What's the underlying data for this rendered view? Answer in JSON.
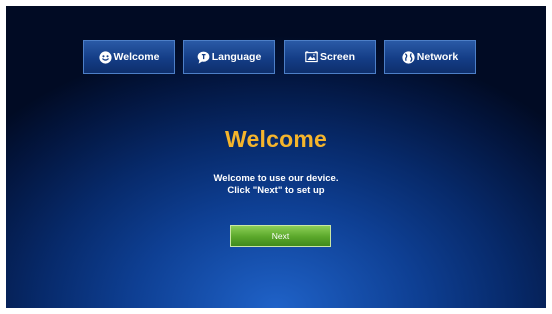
{
  "tabs": [
    {
      "label": "Welcome",
      "icon": "smiley-icon"
    },
    {
      "label": "Language",
      "icon": "speech-bubble-icon"
    },
    {
      "label": "Screen",
      "icon": "screen-icon"
    },
    {
      "label": "Network",
      "icon": "globe-icon"
    }
  ],
  "main": {
    "title": "Welcome",
    "message_line1": "Welcome to use our device.",
    "message_line2": "Click \"Next\" to set up",
    "next_label": "Next"
  },
  "colors": {
    "title": "#f5b52c",
    "button": "#5aa72a",
    "background": "#0e3f93"
  }
}
